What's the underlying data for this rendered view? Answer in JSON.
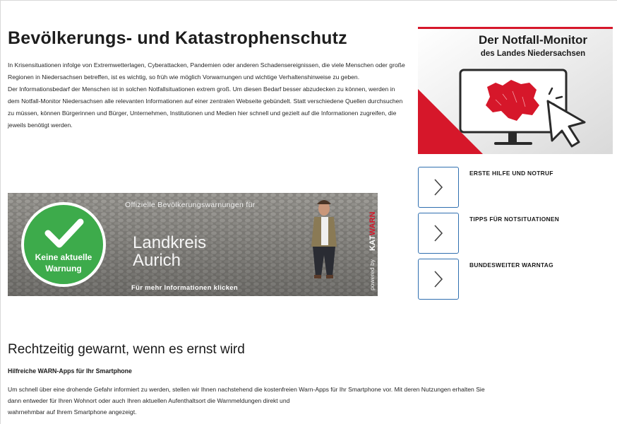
{
  "main": {
    "title": "Bevölkerungs- und Katastrophenschutz",
    "intro_paragraphs": [
      "In Krisensituationen infolge von Extremwetterlagen, Cyberattacken, Pandemien oder anderen Schadensereignissen, die viele Menschen oder große Regionen in Niedersachsen betreffen, ist es wichtig, so früh wie möglich Vorwarnungen und wichtige Verhaltenshinweise zu geben.",
      "Der Informationsbedarf der Menschen ist in solchen Notfallsituationen extrem groß. Um diesen Bedarf besser abzudecken zu können, werden in dem Notfall-Monitor Niedersachsen alle relevanten Informationen auf einer zentralen Webseite gebündelt. Statt verschiedene Quellen durchsuchen zu müssen, können Bürgerinnen und Bürger, Unternehmen, Institutionen und Medien hier schnell und gezielt auf die Informationen zugreifen, die jeweils benötigt werden."
    ]
  },
  "monitor": {
    "title": "Der Notfall-Monitor",
    "subtitle": "des Landes Niedersachsen"
  },
  "links": [
    {
      "label": "ERSTE HILFE UND NOTRUF",
      "icon": "chevron-right-icon"
    },
    {
      "label": "TIPPS FÜR NOTSITUATIONEN",
      "icon": "chevron-right-icon"
    },
    {
      "label": "BUNDESWEITER WARNTAG",
      "icon": "chevron-right-icon"
    }
  ],
  "banner": {
    "status": "Keine aktuelle Warnung",
    "status_line1": "Keine aktuelle",
    "status_line2": "Warnung",
    "official_label": "Offizielle Bevölkerungswarnungen für",
    "region_line1": "Landkreis",
    "region_line2": "Aurich",
    "more_info": "Für mehr Informationen klicken",
    "powered_by": "powered by",
    "brand_kat": "KAT",
    "brand_warn": "WARN",
    "status_color": "#3dab4b"
  },
  "section": {
    "title": "Rechtzeitig gewarnt, wenn es ernst wird",
    "subheading": "Hilfreiche WARN-Apps für Ihr Smartphone",
    "text_lines": [
      "Um schnell über eine drohende Gefahr informiert zu werden, stellen wir Ihnen nachstehend die kostenfreien Warn-Apps für Ihr Smartphone vor. Mit deren Nutzungen erhalten Sie",
      "dann entweder für Ihren Wohnort oder auch Ihren aktuellen Aufenthaltsort die Warnmeldungen direkt und",
      "wahrnehmbar auf Ihrem Smartphone angezeigt."
    ]
  },
  "colors": {
    "accent_red": "#d6172a",
    "link_blue": "#2f6fb0",
    "warn_green": "#3dab4b"
  }
}
